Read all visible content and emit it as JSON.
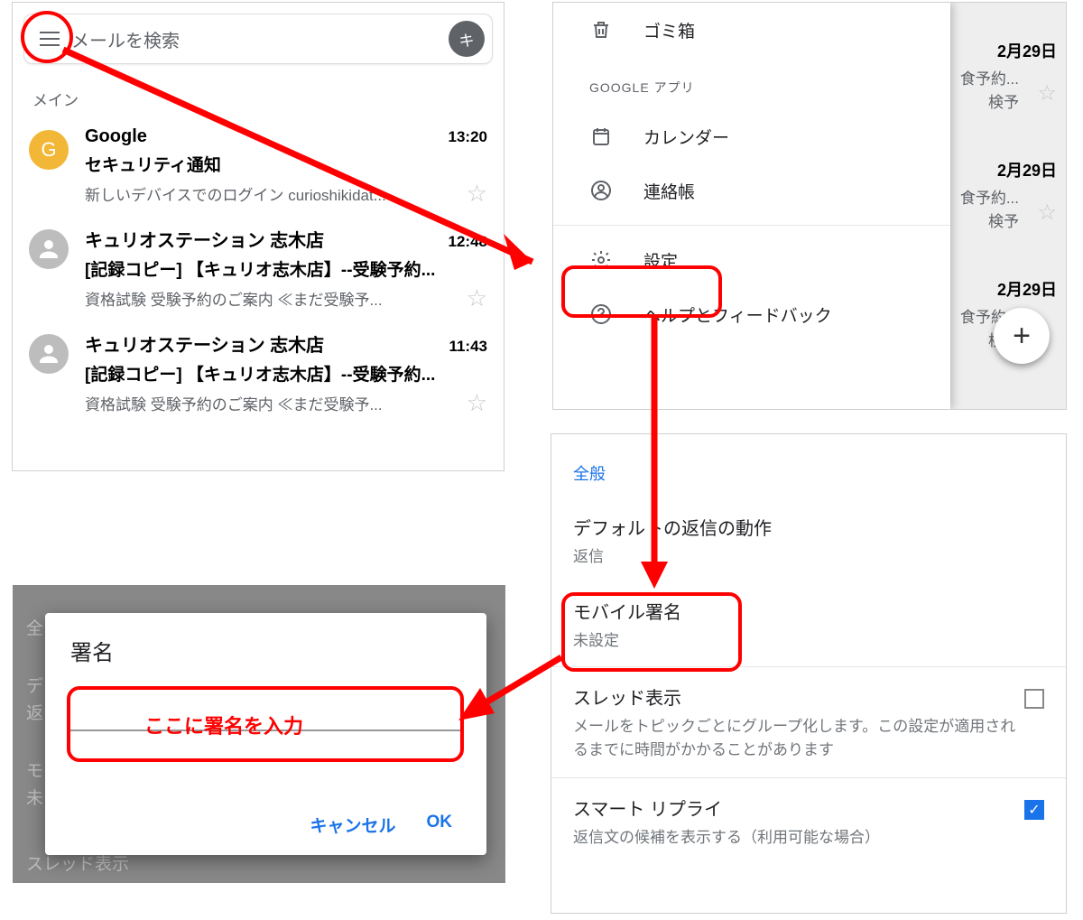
{
  "panelA": {
    "search_placeholder": "メールを検索",
    "avatar_letter": "キ",
    "section_label": "メイン",
    "mails": [
      {
        "sender": "Google",
        "time": "13:20",
        "subject": "セキュリティ通知",
        "snippet": "新しいデバイスでのログイン curioshikidat...",
        "avatar_letter": "G",
        "avatar_color": "gold"
      },
      {
        "sender": "キュリオステーション 志木店",
        "time": "12:48",
        "subject": "[記録コピー] 【キュリオ志木店】--受験予約...",
        "snippet": "資格試験 受験予約のご案内 ≪まだ受験予...",
        "avatar_color": "grey"
      },
      {
        "sender": "キュリオステーション 志木店",
        "time": "11:43",
        "subject": "[記録コピー] 【キュリオ志木店】--受験予約...",
        "snippet": "資格試験 受験予約のご案内 ≪まだ受験予...",
        "avatar_color": "grey"
      }
    ]
  },
  "panelB": {
    "items": [
      {
        "label": "ゴミ箱",
        "icon": "trash"
      }
    ],
    "header": "GOOGLE アプリ",
    "apps": [
      {
        "label": "カレンダー",
        "icon": "calendar"
      },
      {
        "label": "連絡帳",
        "icon": "contacts"
      }
    ],
    "footer": [
      {
        "label": "設定",
        "icon": "settings"
      },
      {
        "label": "ヘルプとフィードバック",
        "icon": "help"
      }
    ],
    "behind_dates": [
      "2月29日",
      "2月29日",
      "2月29日"
    ],
    "behind_frag1": "食予約...",
    "behind_frag2": "検予",
    "fab": "+"
  },
  "panelC": {
    "category": "全般",
    "items": [
      {
        "title": "デフォルトの返信の動作",
        "sub": "返信"
      },
      {
        "title": "モバイル署名",
        "sub": "未設定",
        "highlight": true
      },
      {
        "title": "スレッド表示",
        "sub": "メールをトピックごとにグループ化します。この設定が適用されるまでに時間がかかることがあります",
        "checkbox": false
      },
      {
        "title": "スマート リプライ",
        "sub": "返信文の候補を表示する（利用可能な場合）",
        "checkbox": true
      }
    ]
  },
  "panelD": {
    "behind_general": "全",
    "behind_item1a": "デ",
    "behind_item1b": "返",
    "behind_item2a": "モ",
    "behind_item2b": "未",
    "behind_bottom": "スレッド表示",
    "dialog_title": "署名",
    "dialog_input_label": "ここに署名を入力",
    "cancel": "キャンセル",
    "ok": "OK"
  }
}
